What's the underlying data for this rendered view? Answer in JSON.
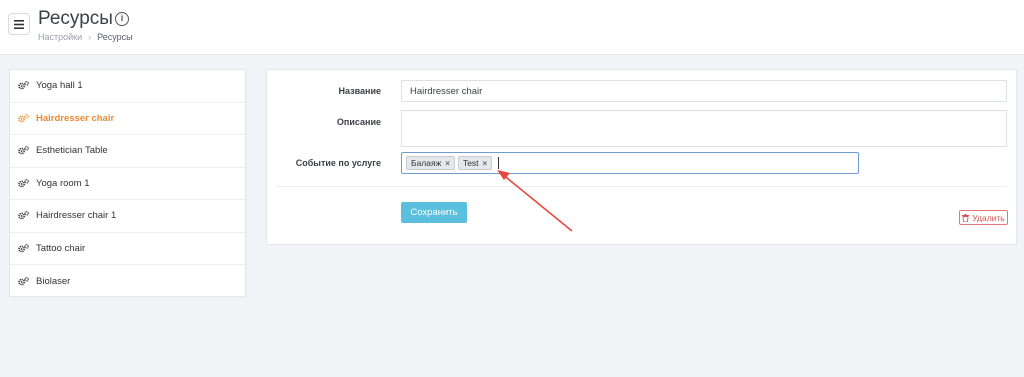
{
  "header": {
    "title": "Ресурсы",
    "info_glyph": "i",
    "breadcrumb": {
      "parent": "Настройки",
      "separator": "›",
      "current": "Ресурсы"
    }
  },
  "sidebar": {
    "items": [
      {
        "label": "Yoga hall 1",
        "active": false
      },
      {
        "label": "Hairdresser chair",
        "active": true
      },
      {
        "label": "Esthetician Table",
        "active": false
      },
      {
        "label": "Yoga room 1",
        "active": false
      },
      {
        "label": "Hairdresser chair 1",
        "active": false
      },
      {
        "label": "Tattoo chair",
        "active": false
      },
      {
        "label": "Biolaser",
        "active": false
      }
    ]
  },
  "form": {
    "name_label": "Название",
    "name_value": "Hairdresser chair",
    "description_label": "Описание",
    "description_value": "",
    "service_event_label": "Событие по услуге",
    "tags": [
      {
        "label": "Балаяж",
        "remove": "×"
      },
      {
        "label": "Test",
        "remove": "×"
      }
    ],
    "save_label": "Сохранить",
    "delete_label": "Удалить"
  },
  "colors": {
    "active_item": "#e98a32",
    "save_button": "#5bc0de",
    "delete_button": "#d9534f",
    "annotation_arrow": "#e8473b"
  },
  "icons": {
    "menu": "hamburger-icon",
    "info": "info-icon",
    "resource": "gears-icon",
    "delete": "trash-icon"
  }
}
